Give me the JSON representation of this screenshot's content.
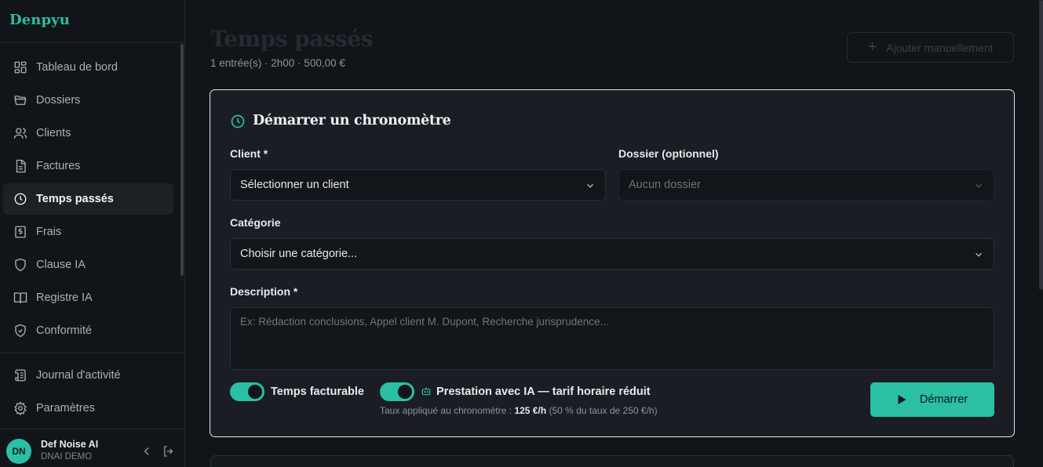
{
  "brand": "Denpyu",
  "nav": {
    "items": [
      {
        "label": "Tableau de bord",
        "icon": "dashboard-icon"
      },
      {
        "label": "Dossiers",
        "icon": "folder-icon"
      },
      {
        "label": "Clients",
        "icon": "users-icon"
      },
      {
        "label": "Factures",
        "icon": "invoice-icon"
      },
      {
        "label": "Temps passés",
        "icon": "clock-icon",
        "active": true
      },
      {
        "label": "Frais",
        "icon": "receipt-icon"
      },
      {
        "label": "Clause IA",
        "icon": "shield-icon"
      },
      {
        "label": "Registre IA",
        "icon": "book-icon"
      },
      {
        "label": "Conformité",
        "icon": "shield-check-icon"
      }
    ],
    "secondary": [
      {
        "label": "Journal d'activité",
        "icon": "scroll-icon"
      },
      {
        "label": "Paramètres",
        "icon": "gear-icon"
      }
    ]
  },
  "user": {
    "initials": "DN",
    "name": "Def Noise AI",
    "org": "DNAI DEMO"
  },
  "header": {
    "title": "Temps passés",
    "subtitle": "1 entrée(s) · 2h00 · 500,00 €",
    "add_button": "Ajouter manuellement"
  },
  "timer": {
    "title": "Démarrer un chronomètre",
    "client_label": "Client *",
    "client_value": "Sélectionner un client",
    "dossier_label": "Dossier (optionnel)",
    "dossier_value": "Aucun dossier",
    "category_label": "Catégorie",
    "category_value": "Choisir une catégorie...",
    "description_label": "Description *",
    "description_placeholder": "Ex: Rédaction conclusions, Appel client M. Dupont, Recherche jurisprudence...",
    "billable_label": "Temps facturable",
    "billable_on": true,
    "ai_label": "Prestation avec IA — tarif horaire réduit",
    "ai_on": true,
    "rate_prefix": "Taux appliqué au chronomètre : ",
    "rate_value": "125 €/h",
    "rate_suffix": " (50 % du taux de 250 €/h)",
    "start_button": "Démarrer"
  },
  "colors": {
    "accent": "#2bbfa4",
    "background": "#111418",
    "card": "#1a1e24"
  }
}
